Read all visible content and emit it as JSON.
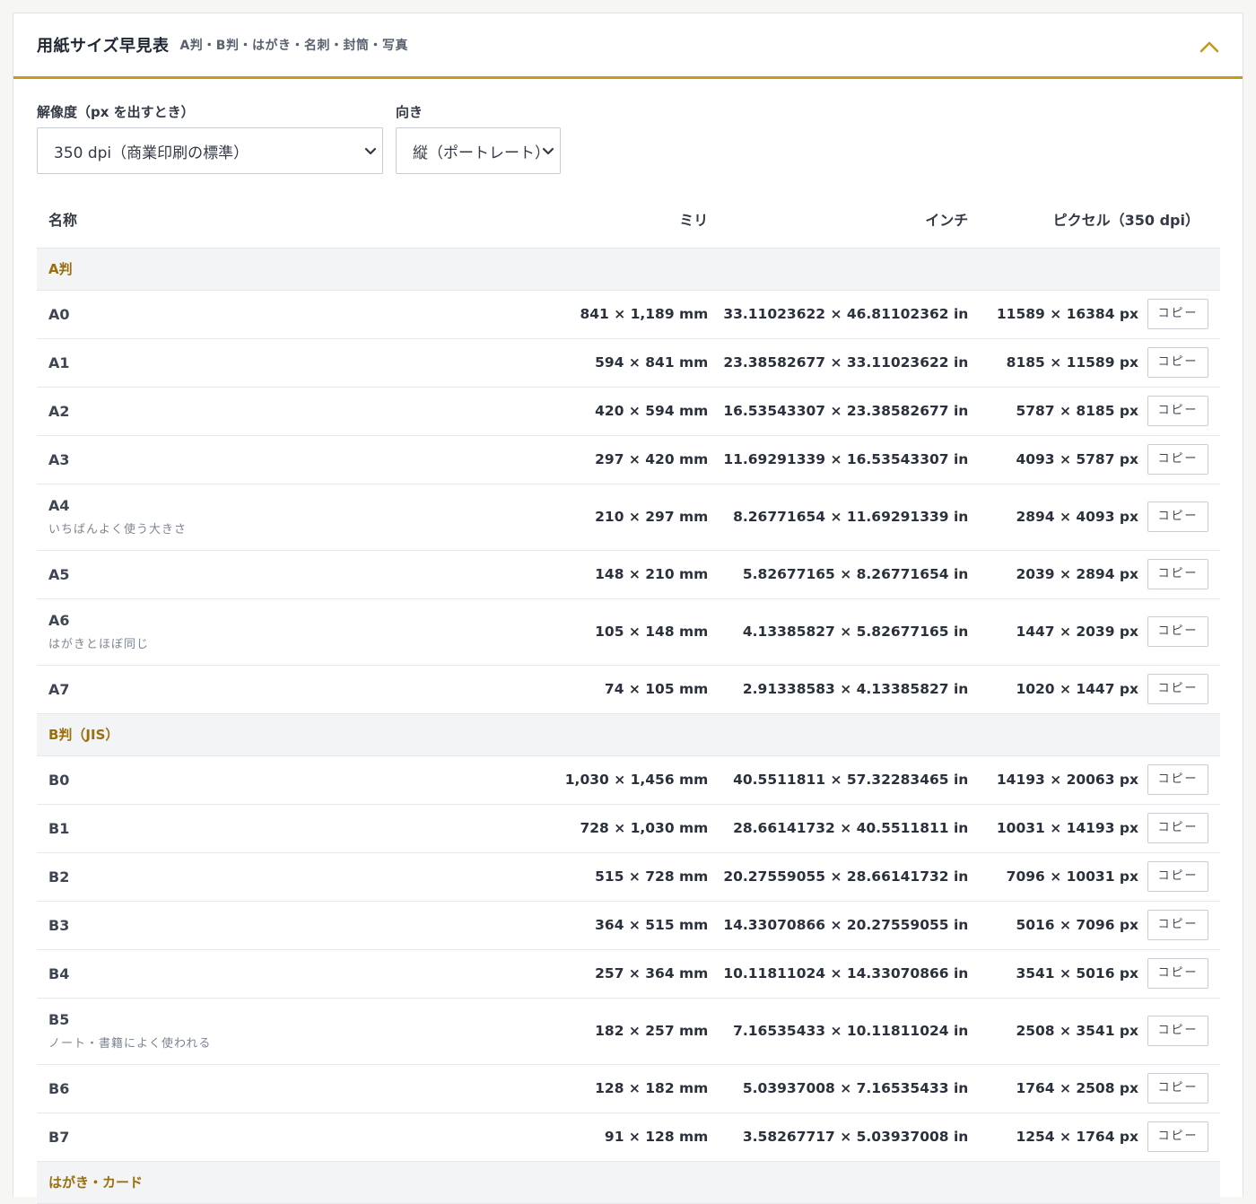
{
  "header": {
    "title": "用紙サイズ早見表",
    "subtitle": "A判・B判・はがき・名刺・封筒・写真",
    "collapse_icon": "chevron-up-icon",
    "accent_color": "#c49a1a"
  },
  "controls": {
    "dpi_label": "解像度（px を出すとき）",
    "dpi_value": "350 dpi（商業印刷の標準）",
    "orientation_label": "向き",
    "orientation_value": "縦（ポートレート）"
  },
  "table": {
    "columns": {
      "name": "名称",
      "mm": "ミリ",
      "inch": "インチ",
      "px": "ピクセル（350 dpi）"
    },
    "copy_label": "コピー",
    "groups": [
      {
        "label": "A判",
        "rows": [
          {
            "name": "A0",
            "note": "",
            "mm": "841 × 1,189 mm",
            "inch": "33.11023622 × 46.81102362 in",
            "px": "11589 × 16384 px"
          },
          {
            "name": "A1",
            "note": "",
            "mm": "594 × 841 mm",
            "inch": "23.38582677 × 33.11023622 in",
            "px": "8185 × 11589 px"
          },
          {
            "name": "A2",
            "note": "",
            "mm": "420 × 594 mm",
            "inch": "16.53543307 × 23.38582677 in",
            "px": "5787 × 8185 px"
          },
          {
            "name": "A3",
            "note": "",
            "mm": "297 × 420 mm",
            "inch": "11.69291339 × 16.53543307 in",
            "px": "4093 × 5787 px"
          },
          {
            "name": "A4",
            "note": "いちばんよく使う大きさ",
            "mm": "210 × 297 mm",
            "inch": "8.26771654 × 11.69291339 in",
            "px": "2894 × 4093 px"
          },
          {
            "name": "A5",
            "note": "",
            "mm": "148 × 210 mm",
            "inch": "5.82677165 × 8.26771654 in",
            "px": "2039 × 2894 px"
          },
          {
            "name": "A6",
            "note": "はがきとほぼ同じ",
            "mm": "105 × 148 mm",
            "inch": "4.13385827 × 5.82677165 in",
            "px": "1447 × 2039 px"
          },
          {
            "name": "A7",
            "note": "",
            "mm": "74 × 105 mm",
            "inch": "2.91338583 × 4.13385827 in",
            "px": "1020 × 1447 px"
          }
        ]
      },
      {
        "label": "B判（JIS）",
        "rows": [
          {
            "name": "B0",
            "note": "",
            "mm": "1,030 × 1,456 mm",
            "inch": "40.5511811 × 57.32283465 in",
            "px": "14193 × 20063 px"
          },
          {
            "name": "B1",
            "note": "",
            "mm": "728 × 1,030 mm",
            "inch": "28.66141732 × 40.5511811 in",
            "px": "10031 × 14193 px"
          },
          {
            "name": "B2",
            "note": "",
            "mm": "515 × 728 mm",
            "inch": "20.27559055 × 28.66141732 in",
            "px": "7096 × 10031 px"
          },
          {
            "name": "B3",
            "note": "",
            "mm": "364 × 515 mm",
            "inch": "14.33070866 × 20.27559055 in",
            "px": "5016 × 7096 px"
          },
          {
            "name": "B4",
            "note": "",
            "mm": "257 × 364 mm",
            "inch": "10.11811024 × 14.33070866 in",
            "px": "3541 × 5016 px"
          },
          {
            "name": "B5",
            "note": "ノート・書籍によく使われる",
            "mm": "182 × 257 mm",
            "inch": "7.16535433 × 10.11811024 in",
            "px": "2508 × 3541 px"
          },
          {
            "name": "B6",
            "note": "",
            "mm": "128 × 182 mm",
            "inch": "5.03937008 × 7.16535433 in",
            "px": "1764 × 2508 px"
          },
          {
            "name": "B7",
            "note": "",
            "mm": "91 × 128 mm",
            "inch": "3.58267717 × 5.03937008 in",
            "px": "1254 × 1764 px"
          }
        ]
      },
      {
        "label": "はがき・カード",
        "rows": []
      }
    ]
  }
}
